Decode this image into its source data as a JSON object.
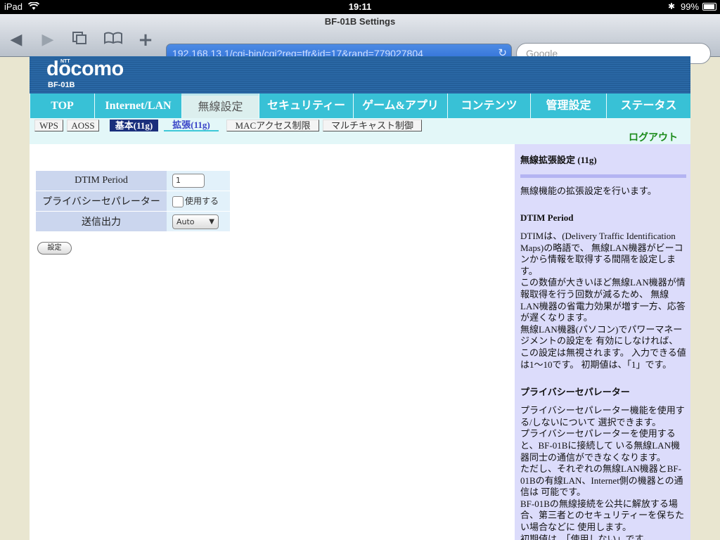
{
  "status_bar": {
    "device": "iPad",
    "time": "19:11",
    "battery": "99%"
  },
  "browser": {
    "page_title": "BF-01B Settings",
    "url": "192.168.13.1/cgi-bin/cgi?req=tfr&id=17&rand=779027804",
    "search_placeholder": "Google"
  },
  "header": {
    "brand_small": "NTT",
    "brand": "docomo",
    "model": "BF-01B"
  },
  "nav": {
    "tabs": [
      "TOP",
      "Internet/LAN",
      "無線設定",
      "セキュリティー",
      "ゲーム&アプリ",
      "コンテンツ",
      "管理設定",
      "ステータス"
    ],
    "active": "無線設定"
  },
  "subnav": {
    "tabs": [
      "WPS",
      "AOSS",
      "基本(11g)",
      "拡張(11g)",
      "MACアクセス制限",
      "マルチキャスト制御"
    ],
    "logout": "ログアウト"
  },
  "form": {
    "dtim_label": "DTIM Period",
    "dtim_value": "1",
    "privacy_label": "プライバシーセパレーター",
    "privacy_checkbox_label": "使用する",
    "privacy_checked": false,
    "power_label": "送信出力",
    "power_value": "Auto",
    "submit_label": "設定"
  },
  "help": {
    "title": "無線拡張設定 (11g)",
    "intro": "無線機能の拡張設定を行います。",
    "sections": [
      {
        "title": "DTIM Period",
        "paragraphs": [
          "DTIMは、(Delivery Traffic Identification Maps)の略語で、 無線LAN機器がビーコンから情報を取得する間隔を設定します。",
          "この数値が大きいほど無線LAN機器が情報取得を行う回数が減るため、 無線LAN機器の省電力効果が増す一方、応答が遅くなります。",
          "無線LAN機器(パソコン)でパワーマネージメントの設定を 有効にしなければ、この設定は無視されます。 入力できる値は1〜10です。 初期値は、「1」です。"
        ]
      },
      {
        "title": "プライバシーセパレーター",
        "paragraphs": [
          "プライバシーセパレーター機能を使用する/しないについて 選択できます。",
          "プライバシーセパレーターを使用すると、BF-01Bに接続して いる無線LAN機器同士の通信ができなくなります。",
          "ただし、それぞれの無線LAN機器とBF-01Bの有線LAN、Internet側の機器との通信は 可能です。",
          "BF-01Bの無線接続を公共に解放する場合、第三者とのセキュリティーを保ちたい場合などに 使用します。",
          "初期値は、「使用しない」です。"
        ]
      }
    ]
  }
}
